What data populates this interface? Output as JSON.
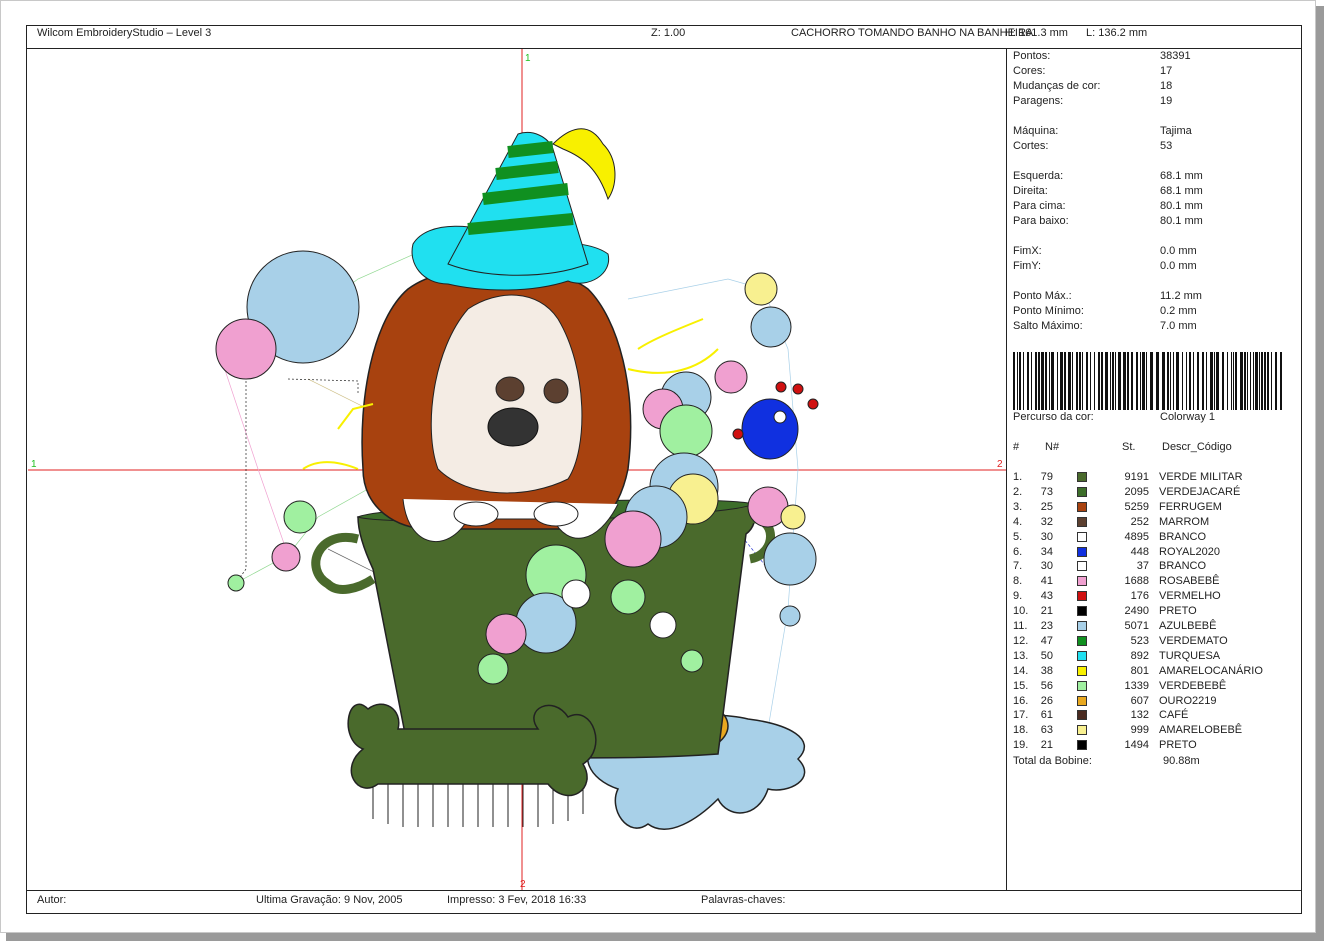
{
  "header": {
    "app": "Wilcom EmbroideryStudio – Level 3",
    "zoom": "Z: 1.00",
    "design_name": "CACHORRO TOMANDO BANHO NA BANHEIRA",
    "height": "H: 161.3 mm",
    "length": "L: 136.2 mm"
  },
  "axes": {
    "left": "1",
    "right": "2",
    "top": "1",
    "bottom": "2"
  },
  "stats": [
    {
      "label": "Pontos:",
      "value": "38391"
    },
    {
      "label": "Cores:",
      "value": "17"
    },
    {
      "label": "Mudanças de cor:",
      "value": "18"
    },
    {
      "label": "Paragens:",
      "value": "19"
    },
    {
      "label": "Máquina:",
      "value": "Tajima"
    },
    {
      "label": "Cortes:",
      "value": "53"
    },
    {
      "label": "Esquerda:",
      "value": "68.1 mm"
    },
    {
      "label": "Direita:",
      "value": "68.1 mm"
    },
    {
      "label": "Para cima:",
      "value": "80.1 mm"
    },
    {
      "label": "Para baixo:",
      "value": "80.1 mm"
    },
    {
      "label": "FimX:",
      "value": "0.0 mm"
    },
    {
      "label": "FimY:",
      "value": "0.0 mm"
    },
    {
      "label": "Ponto Máx.:",
      "value": "11.2 mm"
    },
    {
      "label": "Ponto Mínimo:",
      "value": "0.2 mm"
    },
    {
      "label": "Salto Máximo:",
      "value": "7.0 mm"
    }
  ],
  "colorway": {
    "label": "Percurso da cor:",
    "value": "Colorway 1"
  },
  "table": {
    "headers": {
      "idx": "#",
      "num": "N#",
      "st": "St.",
      "desc": "Descr_Código"
    },
    "rows": [
      {
        "idx": "1.",
        "num": "79",
        "color": "#4a6a2c",
        "st": "9191",
        "desc": "VERDE MILITAR"
      },
      {
        "idx": "2.",
        "num": "73",
        "color": "#3d6e2a",
        "st": "2095",
        "desc": "VERDEJACARÉ"
      },
      {
        "idx": "3.",
        "num": "25",
        "color": "#a8420f",
        "st": "5259",
        "desc": "FERRUGEM"
      },
      {
        "idx": "4.",
        "num": "32",
        "color": "#5c4030",
        "st": "252",
        "desc": "MARROM"
      },
      {
        "idx": "5.",
        "num": "30",
        "color": "#ffffff",
        "st": "4895",
        "desc": "BRANCO"
      },
      {
        "idx": "6.",
        "num": "34",
        "color": "#1030e0",
        "st": "448",
        "desc": "ROYAL2020"
      },
      {
        "idx": "7.",
        "num": "30",
        "color": "#ffffff",
        "st": "37",
        "desc": "BRANCO"
      },
      {
        "idx": "8.",
        "num": "41",
        "color": "#f0a0d0",
        "st": "1688",
        "desc": "ROSABEBÊ"
      },
      {
        "idx": "9.",
        "num": "43",
        "color": "#d01010",
        "st": "176",
        "desc": "VERMELHO"
      },
      {
        "idx": "10.",
        "num": "21",
        "color": "#000000",
        "st": "2490",
        "desc": "PRETO"
      },
      {
        "idx": "11.",
        "num": "23",
        "color": "#a8d0e8",
        "st": "5071",
        "desc": "AZULBEBÊ"
      },
      {
        "idx": "12.",
        "num": "47",
        "color": "#109020",
        "st": "523",
        "desc": "VERDEMATO"
      },
      {
        "idx": "13.",
        "num": "50",
        "color": "#20e0f0",
        "st": "892",
        "desc": "TURQUESA"
      },
      {
        "idx": "14.",
        "num": "38",
        "color": "#f8f000",
        "st": "801",
        "desc": "AMARELOCANÁRIO"
      },
      {
        "idx": "15.",
        "num": "56",
        "color": "#a0f0a0",
        "st": "1339",
        "desc": "VERDEBEBÊ"
      },
      {
        "idx": "16.",
        "num": "26",
        "color": "#e8a820",
        "st": "607",
        "desc": "OURO2219"
      },
      {
        "idx": "17.",
        "num": "61",
        "color": "#4a2a20",
        "st": "132",
        "desc": "CAFÉ"
      },
      {
        "idx": "18.",
        "num": "63",
        "color": "#f8f090",
        "st": "999",
        "desc": "AMARELOBEBÊ"
      },
      {
        "idx": "19.",
        "num": "21",
        "color": "#000000",
        "st": "1494",
        "desc": "PRETO"
      }
    ],
    "total_label": "Total da Bobine:",
    "total_value": "90.88m"
  },
  "footer": {
    "author_label": "Autor:",
    "last_saved": "Ultima Gravação:  9 Nov, 2005",
    "printed": "Impresso:  3 Fev, 2018 16:33",
    "keywords_label": "Palavras-chaves:"
  }
}
